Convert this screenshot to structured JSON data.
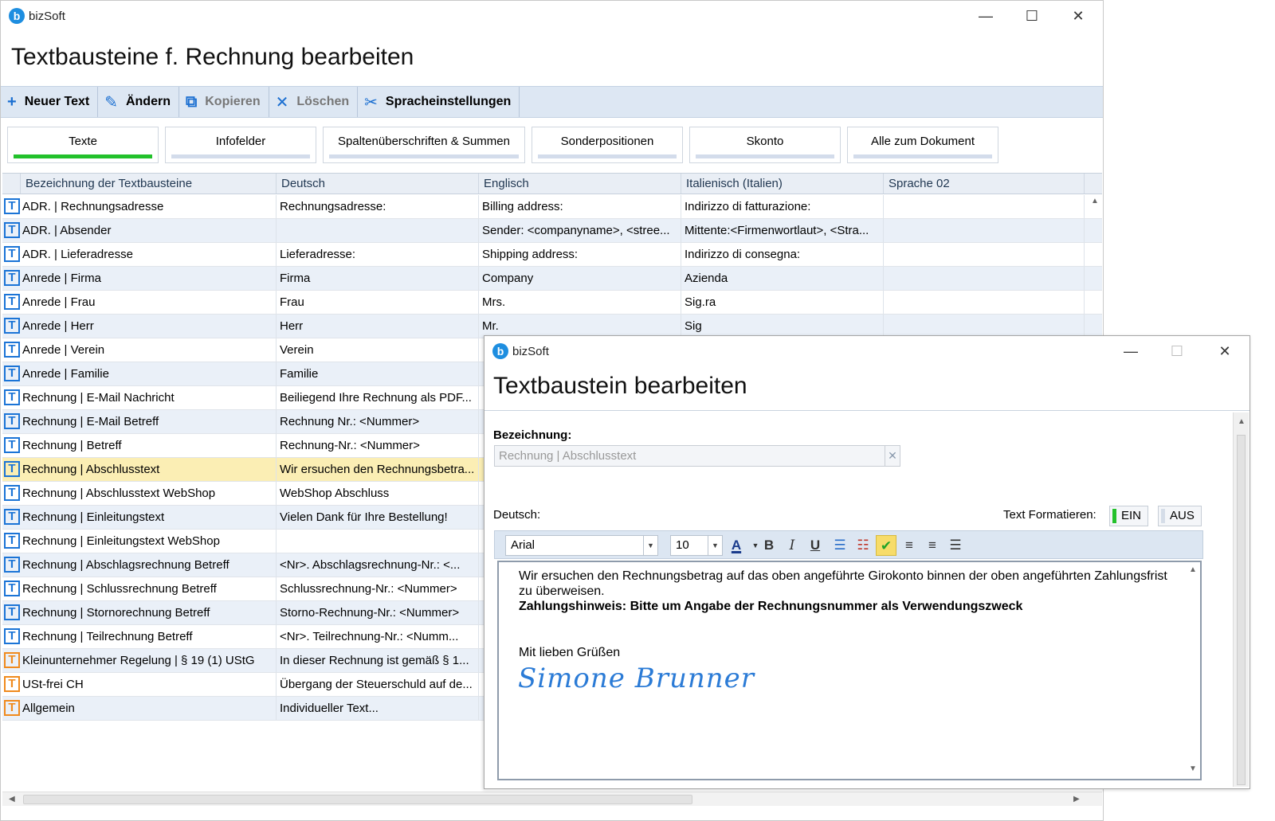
{
  "main_window": {
    "app_name": "bizSoft",
    "title": "Textbausteine f. Rechnung bearbeiten",
    "toolbar": [
      {
        "label": "Neuer Text",
        "icon": "plus-icon",
        "glyph": "+",
        "enabled": true
      },
      {
        "label": "Ändern",
        "icon": "pencil-icon",
        "glyph": "✎",
        "enabled": true
      },
      {
        "label": "Kopieren",
        "icon": "copy-icon",
        "glyph": "⧉",
        "enabled": false
      },
      {
        "label": "Löschen",
        "icon": "delete-x-icon",
        "glyph": "✕",
        "enabled": false
      },
      {
        "label": "Spracheinstellungen",
        "icon": "tools-icon",
        "glyph": "✂",
        "enabled": true
      }
    ],
    "tabs": [
      "Texte",
      "Infofelder",
      "Spaltenüberschriften & Summen",
      "Sonderpositionen",
      "Skonto",
      "Alle zum Dokument"
    ],
    "active_tab": "Texte",
    "columns": [
      "Bezeichnung der Textbausteine",
      "Deutsch",
      "Englisch",
      "Italienisch (Italien)",
      "Sprache 02"
    ],
    "rows": [
      {
        "name": "ADR. | Rechnungsadresse",
        "de": "Rechnungsadresse:",
        "en": "Billing address:",
        "it": "Indirizzo di fatturazione:",
        "s2": "",
        "icon": "blue"
      },
      {
        "name": "ADR. | Absender",
        "de": "",
        "en": "Sender: <companyname>, <stree...",
        "it": "Mittente:<Firmenwortlaut>, <Stra...",
        "s2": "",
        "icon": "blue"
      },
      {
        "name": "ADR. | Lieferadresse",
        "de": "Lieferadresse:",
        "en": "Shipping address:",
        "it": "Indirizzo di consegna:",
        "s2": "",
        "icon": "blue"
      },
      {
        "name": "Anrede | Firma",
        "de": "Firma",
        "en": "Company",
        "it": "Azienda",
        "s2": "",
        "icon": "blue"
      },
      {
        "name": "Anrede | Frau",
        "de": "Frau",
        "en": "Mrs.",
        "it": "Sig.ra",
        "s2": "",
        "icon": "blue"
      },
      {
        "name": "Anrede | Herr",
        "de": "Herr",
        "en": "Mr.",
        "it": "Sig",
        "s2": "",
        "icon": "blue"
      },
      {
        "name": "Anrede | Verein",
        "de": "Verein",
        "en": "",
        "it": "",
        "s2": "",
        "icon": "blue"
      },
      {
        "name": "Anrede | Familie",
        "de": "Familie",
        "en": "",
        "it": "",
        "s2": "",
        "icon": "blue"
      },
      {
        "name": "Rechnung | E-Mail Nachricht",
        "de": "Beiliegend Ihre Rechnung als PDF...",
        "en": "",
        "it": "",
        "s2": "",
        "icon": "blue"
      },
      {
        "name": "Rechnung | E-Mail Betreff",
        "de": "Rechnung Nr.: <Nummer>",
        "en": "",
        "it": "",
        "s2": "",
        "icon": "blue"
      },
      {
        "name": "Rechnung | Betreff",
        "de": "Rechnung-Nr.: <Nummer>",
        "en": "",
        "it": "",
        "s2": "",
        "icon": "blue"
      },
      {
        "name": "Rechnung | Abschlusstext",
        "de": "Wir ersuchen den Rechnungsbetra...",
        "en": "",
        "it": "",
        "s2": "",
        "icon": "blue",
        "selected": true
      },
      {
        "name": "Rechnung | Abschlusstext WebShop",
        "de": "WebShop Abschluss",
        "en": "",
        "it": "",
        "s2": "",
        "icon": "blue"
      },
      {
        "name": "Rechnung | Einleitungstext",
        "de": "Vielen Dank für Ihre Bestellung!",
        "en": "",
        "it": "",
        "s2": "",
        "icon": "blue"
      },
      {
        "name": "Rechnung | Einleitungstext WebShop",
        "de": "",
        "en": "",
        "it": "",
        "s2": "",
        "icon": "blue"
      },
      {
        "name": "Rechnung | Abschlagsrechnung Betreff",
        "de": "<Nr>. Abschlagsrechnung-Nr.: <...",
        "en": "",
        "it": "",
        "s2": "",
        "icon": "blue"
      },
      {
        "name": "Rechnung | Schlussrechnung Betreff",
        "de": "Schlussrechnung-Nr.: <Nummer>",
        "en": "",
        "it": "",
        "s2": "",
        "icon": "blue"
      },
      {
        "name": "Rechnung | Stornorechnung Betreff",
        "de": "Storno-Rechnung-Nr.: <Nummer>",
        "en": "",
        "it": "",
        "s2": "",
        "icon": "blue"
      },
      {
        "name": "Rechnung | Teilrechnung Betreff",
        "de": "<Nr>. Teilrechnung-Nr.: <Numm...",
        "en": "",
        "it": "",
        "s2": "",
        "icon": "blue"
      },
      {
        "name": "Kleinunternehmer Regelung | § 19 (1) UStG",
        "de": "In dieser Rechnung ist gemäß § 1...",
        "en": "",
        "it": "",
        "s2": "",
        "icon": "orange"
      },
      {
        "name": "USt-frei CH",
        "de": "Übergang der Steuerschuld auf de...",
        "en": "",
        "it": "",
        "s2": "",
        "icon": "orange"
      },
      {
        "name": "Allgemein",
        "de": "Individueller Text...",
        "en": "",
        "it": "",
        "s2": "",
        "icon": "orange"
      }
    ]
  },
  "edit_window": {
    "app_name": "bizSoft",
    "title": "Textbaustein bearbeiten",
    "bezeichnung_label": "Bezeichnung:",
    "bezeichnung_value": "Rechnung | Abschlusstext",
    "deutsch_label": "Deutsch:",
    "format_label": "Text Formatieren:",
    "toggle_on": "EIN",
    "toggle_off": "AUS",
    "font": "Arial",
    "font_size": "10",
    "body_line1": "Wir ersuchen den Rechnungsbetrag auf das oben angeführte Girokonto binnen der oben angeführten Zahlungsfrist zu überweisen.",
    "body_bold": "Zahlungshinweis: Bitte um Angabe der Rechnungsnummer als Verwendungszweck",
    "greeting": "Mit lieben Grüßen",
    "signature": "Simone Brunner"
  },
  "colors": {
    "accent_green": "#22c12b",
    "toolbar_bg": "#dde7f3",
    "selected_row": "#fbeeb4",
    "icon_blue": "#1b74d6",
    "icon_orange": "#f08a1d"
  }
}
